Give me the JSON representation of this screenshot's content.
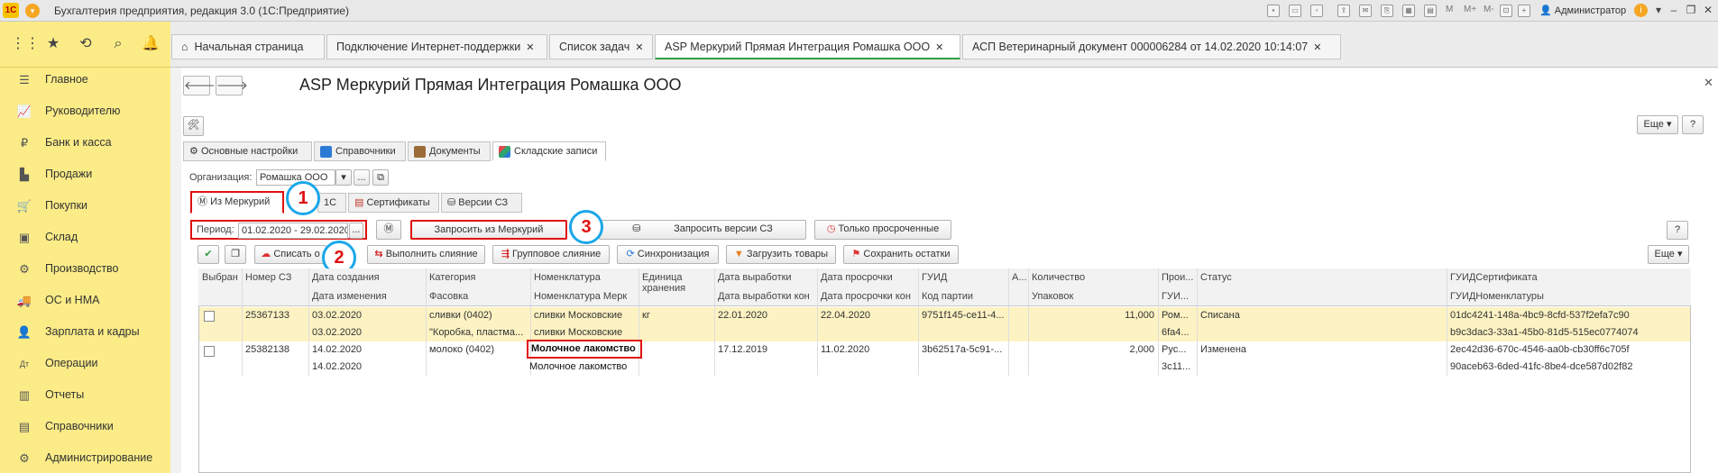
{
  "window": {
    "title": "Бухгалтерия предприятия, редакция 3.0  (1С:Предприятие)",
    "user": "Администратор",
    "tb_m": "M",
    "tb_mplus": "M+",
    "tb_mminus": "M-"
  },
  "sidebar": {
    "items": [
      {
        "label": "Главное",
        "icon": "menu-icon"
      },
      {
        "label": "Руководителю",
        "icon": "chart-icon"
      },
      {
        "label": "Банк и касса",
        "icon": "bank-icon"
      },
      {
        "label": "Продажи",
        "icon": "bag-icon"
      },
      {
        "label": "Покупки",
        "icon": "cart-icon"
      },
      {
        "label": "Склад",
        "icon": "warehouse-icon"
      },
      {
        "label": "Производство",
        "icon": "factory-icon"
      },
      {
        "label": "ОС и НМА",
        "icon": "truck-icon"
      },
      {
        "label": "Зарплата и кадры",
        "icon": "person-icon"
      },
      {
        "label": "Операции",
        "icon": "dtkt-icon"
      },
      {
        "label": "Отчеты",
        "icon": "report-icon"
      },
      {
        "label": "Справочники",
        "icon": "book-icon"
      },
      {
        "label": "Администрирование",
        "icon": "gear-icon"
      }
    ]
  },
  "tabs": [
    {
      "label": "Начальная страница"
    },
    {
      "label": "Подключение Интернет-поддержки"
    },
    {
      "label": "Список задач"
    },
    {
      "label": "ASP Меркурий Прямая Интеграция Ромашка ООО"
    },
    {
      "label": "АСП Ветеринарный документ 000006284 от 14.02.2020 10:14:07"
    }
  ],
  "form": {
    "title": "ASP Меркурий Прямая Интеграция Ромашка ООО",
    "more_label": "Еще",
    "help_label": "?",
    "main_tabs": [
      "Основные настройки",
      "Справочники",
      "Документы",
      "Складские записи"
    ],
    "org_label": "Организация:",
    "org_value": "Ромашка ООО",
    "ellipsis": "...",
    "sub_tabs": [
      "Из Меркурий",
      "1С",
      "Сертификаты",
      "Версии СЗ"
    ],
    "period_label": "Период:",
    "period_value": "01.02.2020 - 29.02.2020",
    "request_button": "Запросить из Меркурий",
    "versions_button": "Запросить версии СЗ",
    "expired_button": "Только просроченные",
    "actions": [
      "Списать о",
      "Выполнить слияние",
      "Групповое слияние",
      "Синхронизация",
      "Загрузить товары",
      "Сохранить остатки"
    ],
    "callouts": [
      "1",
      "2",
      "3"
    ]
  },
  "table": {
    "headers": [
      {
        "top": "Выбран",
        "bottom": ""
      },
      {
        "top": "Номер СЗ",
        "bottom": ""
      },
      {
        "top": "Дата создания",
        "bottom": "Дата изменения"
      },
      {
        "top": "Категория",
        "bottom": "Фасовка"
      },
      {
        "top": "Номенклатура",
        "bottom": "Номенклатура Мерк"
      },
      {
        "top": "Единица хранения",
        "bottom": ""
      },
      {
        "top": "Дата выработки",
        "bottom": "Дата выработки кон"
      },
      {
        "top": "Дата просрочки",
        "bottom": "Дата просрочки кон"
      },
      {
        "top": "ГУИД",
        "bottom": "Код партии"
      },
      {
        "top": "А...",
        "bottom": ""
      },
      {
        "top": "Количество",
        "bottom": "Упаковок"
      },
      {
        "top": "Прои...",
        "bottom": "ГУИ..."
      },
      {
        "top": "Статус",
        "bottom": ""
      },
      {
        "top": "ГУИДСертификата",
        "bottom": "ГУИДНоменклатуры"
      }
    ],
    "rows": [
      {
        "selected": false,
        "number": "25367133",
        "date_created": "03.02.2020",
        "date_changed": "03.02.2020",
        "category": "сливки (0402)",
        "packing": "\"Коробка, пластма...",
        "nomenclature": "сливки Московские",
        "nomenclature_merc": "сливки Московские",
        "unit": "кг",
        "prod_date": "22.01.2020",
        "prod_date_end": "",
        "exp_date": "22.04.2020",
        "exp_date_end": "",
        "guid": "9751f145-ce11-4...",
        "batch": "",
        "a": "",
        "qty": "11,000",
        "packs": "",
        "prod": "Ром...",
        "guid2": "6fa4...",
        "status": "Списана",
        "cert_guid": "01dc4241-148a-4bc9-8cfd-537f2efa7c90",
        "nom_guid": "b9c3dac3-33a1-45b0-81d5-515ec0774074"
      },
      {
        "selected": false,
        "number": "25382138",
        "date_created": "14.02.2020",
        "date_changed": "14.02.2020",
        "category": "молоко (0402)",
        "packing": "",
        "nomenclature": "Молочное лакомство",
        "nomenclature_merc": "Молочное лакомство",
        "unit": "",
        "prod_date": "17.12.2019",
        "prod_date_end": "",
        "exp_date": "11.02.2020",
        "exp_date_end": "",
        "guid": "3b62517a-5c91-...",
        "batch": "",
        "a": "",
        "qty": "2,000",
        "packs": "",
        "prod": "Рус...",
        "guid2": "3c11...",
        "status": "Изменена",
        "cert_guid": "2ec42d36-670c-4546-aa0b-cb30ff6c705f",
        "nom_guid": "90aceb63-6ded-41fc-8be4-dce587d02f82"
      }
    ]
  }
}
